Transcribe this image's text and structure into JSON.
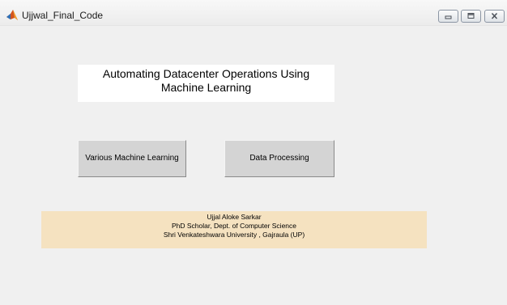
{
  "window": {
    "title": "Ujjwal_Final_Code",
    "app_icon": "matlab-icon",
    "controls": [
      "minimize-icon",
      "maximize-icon",
      "close-icon"
    ]
  },
  "heading": {
    "line1": "Automating Datacenter Operations Using",
    "line2": "Machine Learning"
  },
  "buttons": {
    "ml_label": "Various Machine Learning",
    "dp_label": "Data Processing"
  },
  "credits": {
    "name": "Ujjal Aloke Sarkar",
    "position": "PhD Scholar, Dept. of Computer Science",
    "institution": "Shri Venkateshwara University , Gajraula (UP)"
  },
  "colors": {
    "window_bg": "#f0f0f0",
    "heading_bg": "#ffffff",
    "button_bg": "#d4d4d4",
    "credits_bg": "#f5e2c0"
  }
}
